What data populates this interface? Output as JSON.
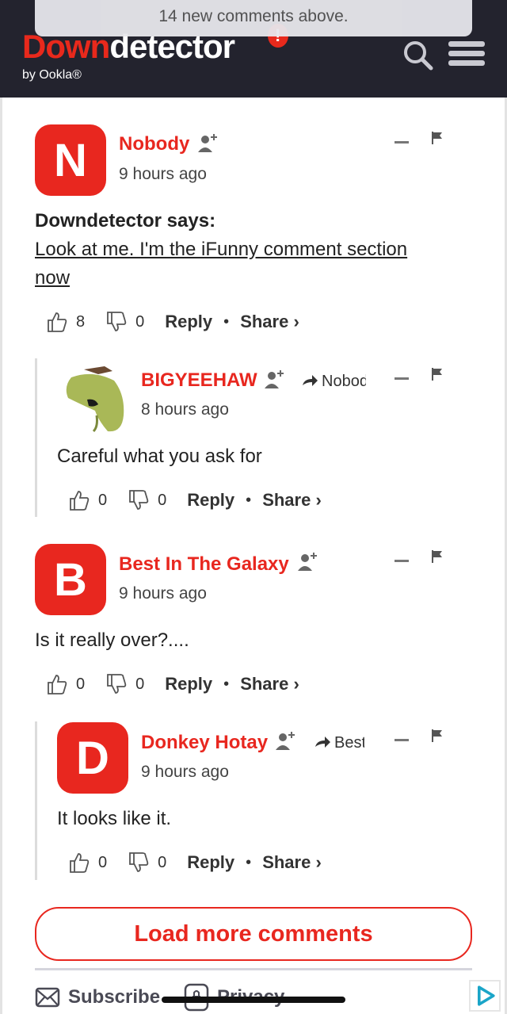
{
  "banner": {
    "new_comments": "14 new comments above."
  },
  "header": {
    "logo_down": "Down",
    "logo_detector": "detector",
    "byline": "by Ookla®",
    "bg_color": "#23232e",
    "brand_color": "#e8291c",
    "search_icon": "search-icon",
    "menu_icon": "menu-icon"
  },
  "comments": [
    {
      "avatar_letter": "N",
      "author": "Nobody",
      "time": "9 hours ago",
      "title": "Downdetector says:",
      "text": "Look at me. I'm the iFunny comment section now",
      "likes": "8",
      "dislikes": "0",
      "reply_label": "Reply",
      "share_label": "Share ›"
    },
    {
      "avatar_kind": "image",
      "author": "BIGYEEHAW",
      "reply_to": "Nobody",
      "time": "8 hours ago",
      "text": "Careful what you ask for",
      "likes": "0",
      "dislikes": "0",
      "reply_label": "Reply",
      "share_label": "Share ›"
    },
    {
      "avatar_letter": "B",
      "author": "Best In The Galaxy",
      "time": "9 hours ago",
      "text": "Is it really over?....",
      "likes": "0",
      "dislikes": "0",
      "reply_label": "Reply",
      "share_label": "Share ›"
    },
    {
      "avatar_letter": "D",
      "author": "Donkey Hotay",
      "reply_to": "Best In The Galaxy",
      "time": "9 hours ago",
      "text": "It looks like it.",
      "likes": "0",
      "dislikes": "0",
      "reply_label": "Reply",
      "share_label": "Share ›"
    }
  ],
  "load_more": "Load more comments",
  "footer": {
    "subscribe": "Subscribe",
    "privacy": "Privacy"
  }
}
